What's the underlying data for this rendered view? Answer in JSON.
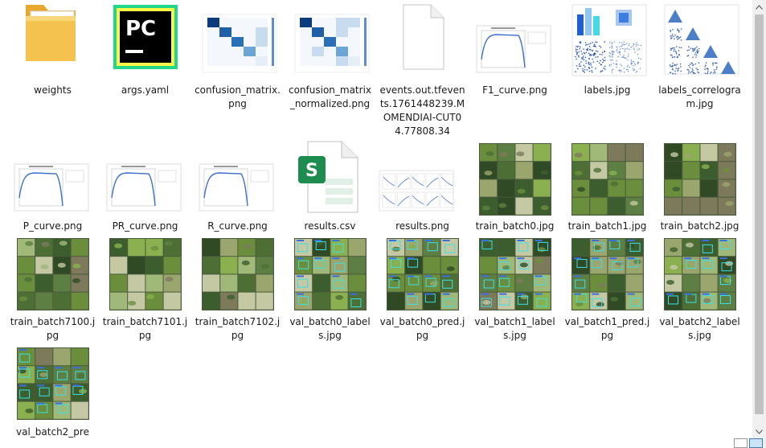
{
  "files": [
    {
      "name": "weights",
      "type": "folder"
    },
    {
      "name": "args.yaml",
      "type": "pycharm"
    },
    {
      "name": "confusion_matrix.png",
      "type": "confusion"
    },
    {
      "name": "confusion_matrix_normalized.png",
      "type": "confusion"
    },
    {
      "name": "events.out.tfevents.1761448239.MOMENDIAI-CUT04.77808.34",
      "type": "blank"
    },
    {
      "name": "F1_curve.png",
      "type": "curve"
    },
    {
      "name": "labels.jpg",
      "type": "labels"
    },
    {
      "name": "labels_correlogram.jpg",
      "type": "correlogram"
    },
    {
      "name": "P_curve.png",
      "type": "curve"
    },
    {
      "name": "PR_curve.png",
      "type": "curve"
    },
    {
      "name": "R_curve.png",
      "type": "curve"
    },
    {
      "name": "results.csv",
      "type": "sheet"
    },
    {
      "name": "results.png",
      "type": "results"
    },
    {
      "name": "train_batch0.jpg",
      "type": "mosaic"
    },
    {
      "name": "train_batch1.jpg",
      "type": "mosaic"
    },
    {
      "name": "train_batch2.jpg",
      "type": "mosaic"
    },
    {
      "name": "train_batch7100.jpg",
      "type": "mosaic"
    },
    {
      "name": "train_batch7101.jpg",
      "type": "mosaic"
    },
    {
      "name": "train_batch7102.jpg",
      "type": "mosaic"
    },
    {
      "name": "val_batch0_labels.jpg",
      "type": "valmosaic"
    },
    {
      "name": "val_batch0_pred.jpg",
      "type": "valmosaic"
    },
    {
      "name": "val_batch1_labels.jpg",
      "type": "valmosaic"
    },
    {
      "name": "val_batch1_pred.jpg",
      "type": "valmosaic"
    },
    {
      "name": "val_batch2_labels.jpg",
      "type": "valmosaic"
    },
    {
      "name": "val_batch2_pre",
      "type": "valmosaic"
    }
  ],
  "colors": {
    "folder": "#f3c24f",
    "pycharm_bg": "#000000",
    "pycharm_text": "#ffffff",
    "sheet_green": "#1e8c4e",
    "selection": "#cce4f7"
  }
}
